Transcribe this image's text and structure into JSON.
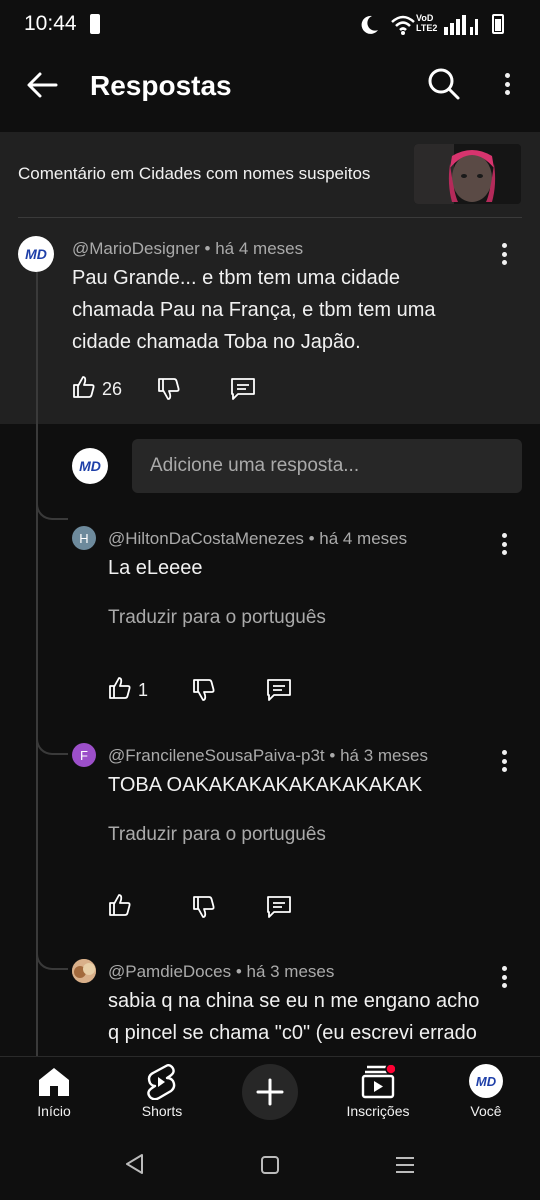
{
  "status_bar": {
    "time": "10:44",
    "lte_label_top": "VoD",
    "lte_label_bottom": "LTE2"
  },
  "header": {
    "title": "Respostas",
    "icons": [
      "back-arrow-icon",
      "search-icon",
      "more-vert-icon"
    ]
  },
  "context": {
    "text": "Comentário em Cidades com nomes suspeitos"
  },
  "main_comment": {
    "author": "@MarioDesigner",
    "time": "há 4 meses",
    "lines": [
      "Pau Grande... e tbm tem uma cidade",
      "chamada Pau na França, e tbm tem uma",
      "cidade chamada Toba no Japão."
    ],
    "likes": "26"
  },
  "reply_box": {
    "avatar_text": "MD",
    "placeholder": "Adicione uma resposta..."
  },
  "replies": [
    {
      "author": "@HiltonDaCostaMenezes",
      "time": "há 4 meses",
      "initial": "H",
      "avatar_color": "#6d8a9c",
      "text": "La eLeeee",
      "translate": "Traduzir para o português",
      "likes": "1"
    },
    {
      "author": "@FrancileneSousaPaiva-p3t",
      "time": "há 3 meses",
      "initial": "F",
      "avatar_color": "#9c4fc9",
      "text": "TOBA OAKAKAKAKAKAKAKAKAK",
      "translate": "Traduzir para o português",
      "likes": ""
    },
    {
      "author": "@PamdieDoces",
      "time": "há 3 meses",
      "lines": [
        "sabia q na china se eu n me engano acho",
        "q pincel se chama \"c0\" (eu escrevi errado"
      ]
    }
  ],
  "bottom_nav": [
    {
      "label": "Início",
      "icon": "home-icon"
    },
    {
      "label": "Shorts",
      "icon": "shorts-icon"
    },
    {
      "label": "",
      "icon": "create-plus-icon"
    },
    {
      "label": "Inscrições",
      "icon": "subscriptions-icon"
    },
    {
      "label": "Você",
      "icon": "profile-avatar-icon"
    }
  ],
  "system_nav": [
    "back-triangle-icon",
    "home-square-icon",
    "recents-lines-icon"
  ],
  "colors": {
    "background": "#0f0f0f",
    "surface": "#212121",
    "muted_text": "#aaaaaa",
    "notification_dot": "#ff0033",
    "md_blue": "#1e3fa8"
  }
}
